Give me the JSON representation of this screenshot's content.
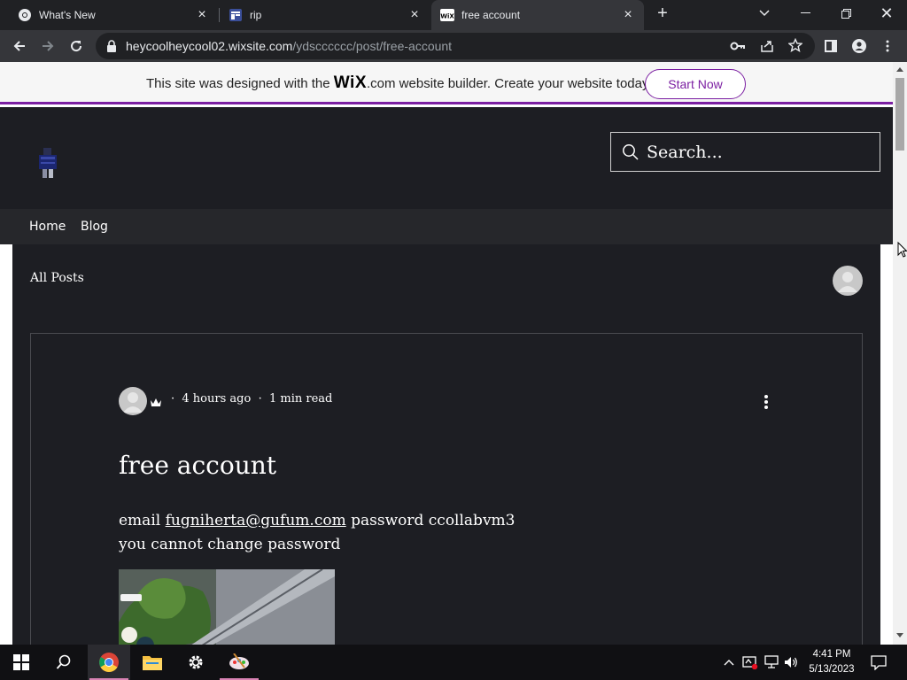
{
  "browser": {
    "tabs": [
      {
        "title": "What's New",
        "icon": "chrome-icon"
      },
      {
        "title": "rip",
        "icon": "site-icon"
      },
      {
        "title": "free account",
        "icon": "wix-icon",
        "active": true
      }
    ],
    "url_domain": "heycoolheycool02.wixsite.com",
    "url_path": "/ydscccccc/post/free-account"
  },
  "wix_banner": {
    "text_before": "This site was designed with the",
    "brand": "WiX",
    "text_after": ".com website builder. Create your website today.",
    "cta": "Start Now",
    "accent": "#7b1fa2"
  },
  "site": {
    "search_placeholder": "Search...",
    "nav": [
      "Home",
      "Blog"
    ]
  },
  "blog": {
    "all_posts": "All Posts",
    "post": {
      "time": "4 hours ago",
      "read_time": "1 min read",
      "title": "free account",
      "body_email_label": "email",
      "body_email": "fugniherta@gufum.com",
      "body_password": "password ccollabvm3",
      "body_line2": "you cannot change password"
    }
  },
  "taskbar": {
    "time": "4:41 PM",
    "date": "5/13/2023"
  },
  "colors": {
    "site_bg": "#1d1e23",
    "nav_bg": "#26272b",
    "browser_bg": "#202124"
  }
}
